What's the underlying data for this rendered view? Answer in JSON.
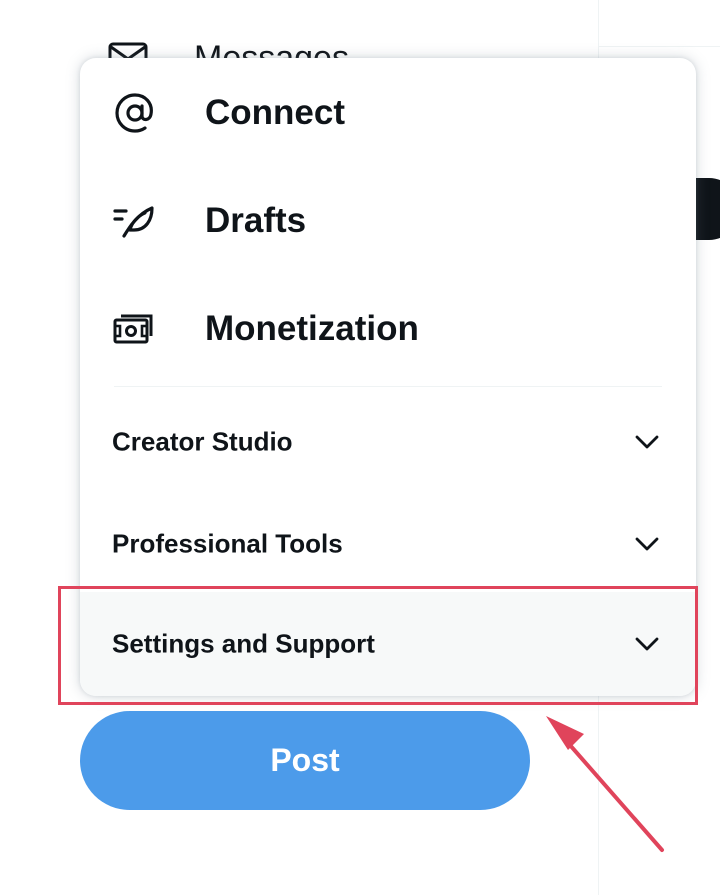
{
  "background": {
    "nav_item_label": "Messages",
    "nav_item_icon": "envelope-icon"
  },
  "menu": {
    "items": [
      {
        "label": "Connect",
        "icon": "at-sign-icon"
      },
      {
        "label": "Drafts",
        "icon": "drafts-quill-icon"
      },
      {
        "label": "Monetization",
        "icon": "money-bill-icon"
      }
    ],
    "sections": [
      {
        "label": "Creator Studio",
        "icon": "chevron-down-icon",
        "expanded": false
      },
      {
        "label": "Professional Tools",
        "icon": "chevron-down-icon",
        "expanded": false
      },
      {
        "label": "Settings and Support",
        "icon": "chevron-down-icon",
        "expanded": false,
        "highlighted": true
      }
    ]
  },
  "post_button": {
    "label": "Post"
  },
  "colors": {
    "text": "#0f1419",
    "post_button": "#4c9bea",
    "highlight_annotation": "#e0445b",
    "hover_row": "#f7f9f9",
    "divider": "#eff3f4"
  }
}
